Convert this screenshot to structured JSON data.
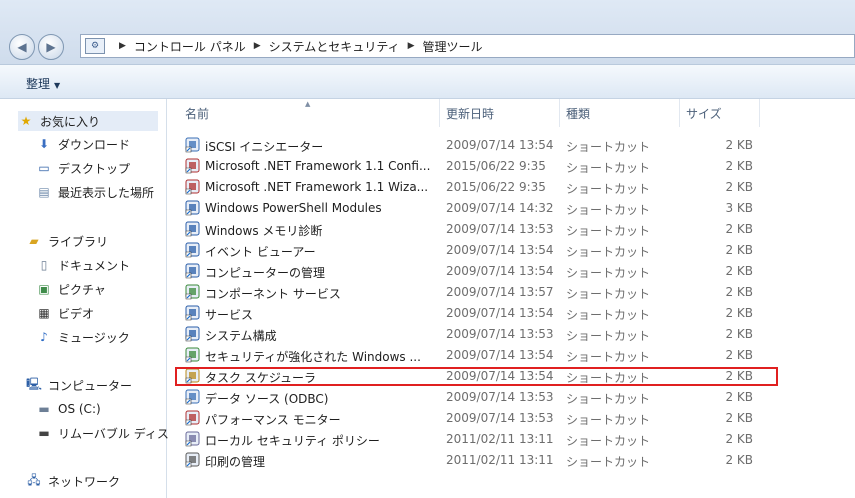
{
  "address": {
    "crumbs": [
      "コントロール パネル",
      "システムとセキュリティ",
      "管理ツール"
    ]
  },
  "toolbar": {
    "organize_label": "整理"
  },
  "nav": {
    "favorites": {
      "label": "お気に入り",
      "items": [
        "ダウンロード",
        "デスクトップ",
        "最近表示した場所"
      ]
    },
    "libraries": {
      "label": "ライブラリ",
      "items": [
        "ドキュメント",
        "ピクチャ",
        "ビデオ",
        "ミュージック"
      ]
    },
    "computer": {
      "label": "コンピューター",
      "items": [
        "OS (C:)",
        "リムーバブル ディス"
      ]
    },
    "network": {
      "label": "ネットワーク"
    }
  },
  "columns": {
    "name": "名前",
    "date": "更新日時",
    "type": "種類",
    "size": "サイズ"
  },
  "files": [
    {
      "name": "iSCSI イニシエーター",
      "date": "2009/07/14 13:54",
      "type": "ショートカット",
      "size": "2 KB"
    },
    {
      "name": "Microsoft .NET Framework 1.1 Confi...",
      "date": "2015/06/22 9:35",
      "type": "ショートカット",
      "size": "2 KB"
    },
    {
      "name": "Microsoft .NET Framework 1.1 Wiza...",
      "date": "2015/06/22 9:35",
      "type": "ショートカット",
      "size": "2 KB"
    },
    {
      "name": "Windows PowerShell Modules",
      "date": "2009/07/14 14:32",
      "type": "ショートカット",
      "size": "3 KB"
    },
    {
      "name": "Windows メモリ診断",
      "date": "2009/07/14 13:53",
      "type": "ショートカット",
      "size": "2 KB"
    },
    {
      "name": "イベント ビューアー",
      "date": "2009/07/14 13:54",
      "type": "ショートカット",
      "size": "2 KB"
    },
    {
      "name": "コンピューターの管理",
      "date": "2009/07/14 13:54",
      "type": "ショートカット",
      "size": "2 KB"
    },
    {
      "name": "コンポーネント サービス",
      "date": "2009/07/14 13:57",
      "type": "ショートカット",
      "size": "2 KB"
    },
    {
      "name": "サービス",
      "date": "2009/07/14 13:54",
      "type": "ショートカット",
      "size": "2 KB"
    },
    {
      "name": "システム構成",
      "date": "2009/07/14 13:53",
      "type": "ショートカット",
      "size": "2 KB"
    },
    {
      "name": "セキュリティが強化された Windows ...",
      "date": "2009/07/14 13:54",
      "type": "ショートカット",
      "size": "2 KB"
    },
    {
      "name": "タスク スケジューラ",
      "date": "2009/07/14 13:54",
      "type": "ショートカット",
      "size": "2 KB"
    },
    {
      "name": "データ ソース (ODBC)",
      "date": "2009/07/14 13:53",
      "type": "ショートカット",
      "size": "2 KB"
    },
    {
      "name": "パフォーマンス モニター",
      "date": "2009/07/14 13:53",
      "type": "ショートカット",
      "size": "2 KB"
    },
    {
      "name": "ローカル セキュリティ ポリシー",
      "date": "2011/02/11 13:11",
      "type": "ショートカット",
      "size": "2 KB"
    },
    {
      "name": "印刷の管理",
      "date": "2011/02/11 13:11",
      "type": "ショートカット",
      "size": "2 KB"
    }
  ],
  "highlighted_file": "タスク スケジューラ",
  "colors": {
    "highlight_border": "#e02020"
  }
}
